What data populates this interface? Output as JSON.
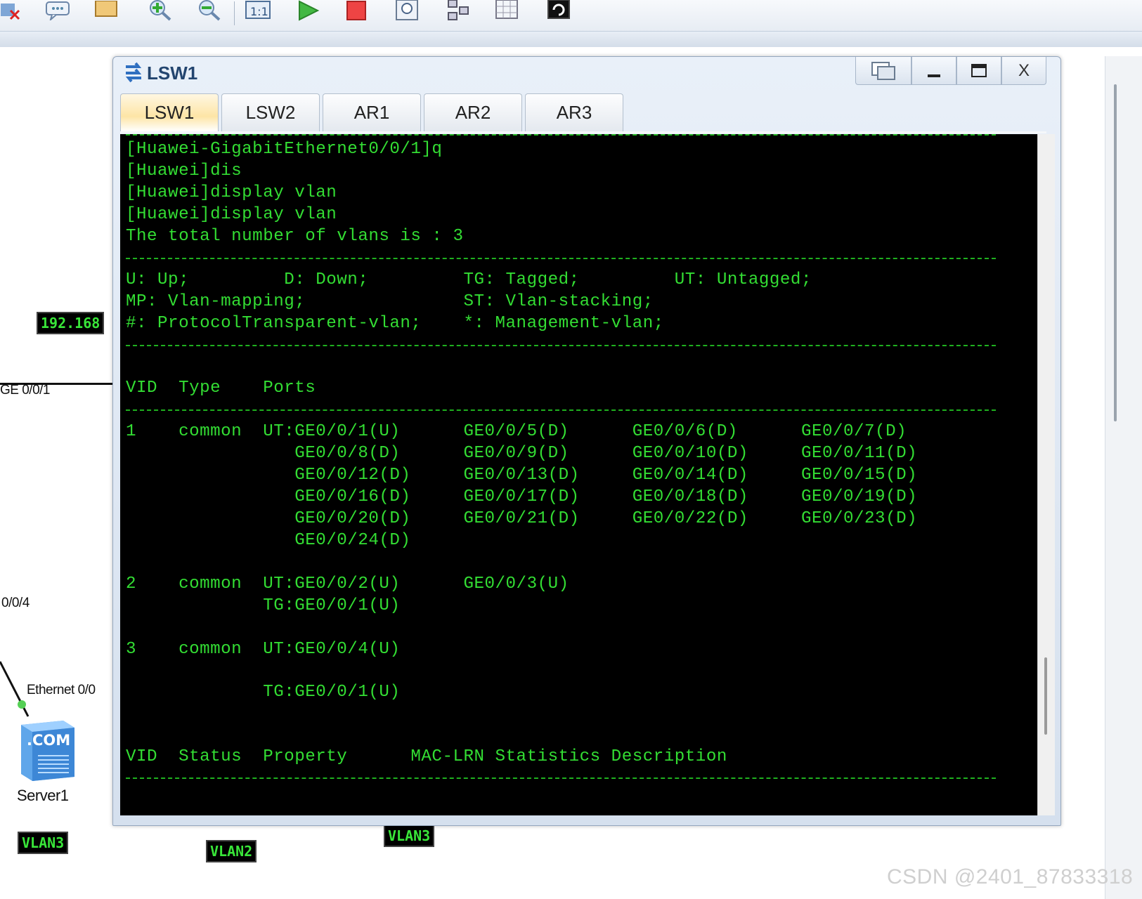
{
  "window": {
    "title": "LSW1",
    "controls": [
      "restore-console",
      "minimize",
      "maximize",
      "close"
    ],
    "close_label": "X"
  },
  "tabs": [
    {
      "label": "LSW1",
      "active": true
    },
    {
      "label": "LSW2",
      "active": false
    },
    {
      "label": "AR1",
      "active": false
    },
    {
      "label": "AR2",
      "active": false
    },
    {
      "label": "AR3",
      "active": false
    }
  ],
  "console": {
    "lines": [
      "[Huawei-GigabitEthernet0/0/1]q",
      "[Huawei]dis",
      "[Huawei]display vlan",
      "[Huawei]display vlan",
      "The total number of vlans is : 3",
      "U: Up;         D: Down;         TG: Tagged;         UT: Untagged;",
      "MP: Vlan-mapping;               ST: Vlan-stacking;",
      "#: ProtocolTransparent-vlan;    *: Management-vlan;",
      "VID  Type    Ports",
      "1    common  UT:GE0/0/1(U)      GE0/0/5(D)      GE0/0/6(D)      GE0/0/7(D)",
      "                GE0/0/8(D)      GE0/0/9(D)      GE0/0/10(D)     GE0/0/11(D)",
      "                GE0/0/12(D)     GE0/0/13(D)     GE0/0/14(D)     GE0/0/15(D)",
      "                GE0/0/16(D)     GE0/0/17(D)     GE0/0/18(D)     GE0/0/19(D)",
      "                GE0/0/20(D)     GE0/0/21(D)     GE0/0/22(D)     GE0/0/23(D)",
      "                GE0/0/24(D)",
      "2    common  UT:GE0/0/2(U)      GE0/0/3(U)",
      "             TG:GE0/0/1(U)",
      "3    common  UT:GE0/0/4(U)",
      "             TG:GE0/0/1(U)",
      "VID  Status  Property      MAC-LRN Statistics Description"
    ]
  },
  "topology": {
    "ip_label": "192.168",
    "port_ge": "GE 0/0/1",
    "port_004": "0/0/4",
    "port_eth": "Ethernet 0/0",
    "server_name": "Server1",
    "server_badge": ".COM",
    "vlan_labels": [
      "VLAN3",
      "VLAN2",
      "VLAN3"
    ]
  },
  "watermark": "CSDN @2401_87833318"
}
